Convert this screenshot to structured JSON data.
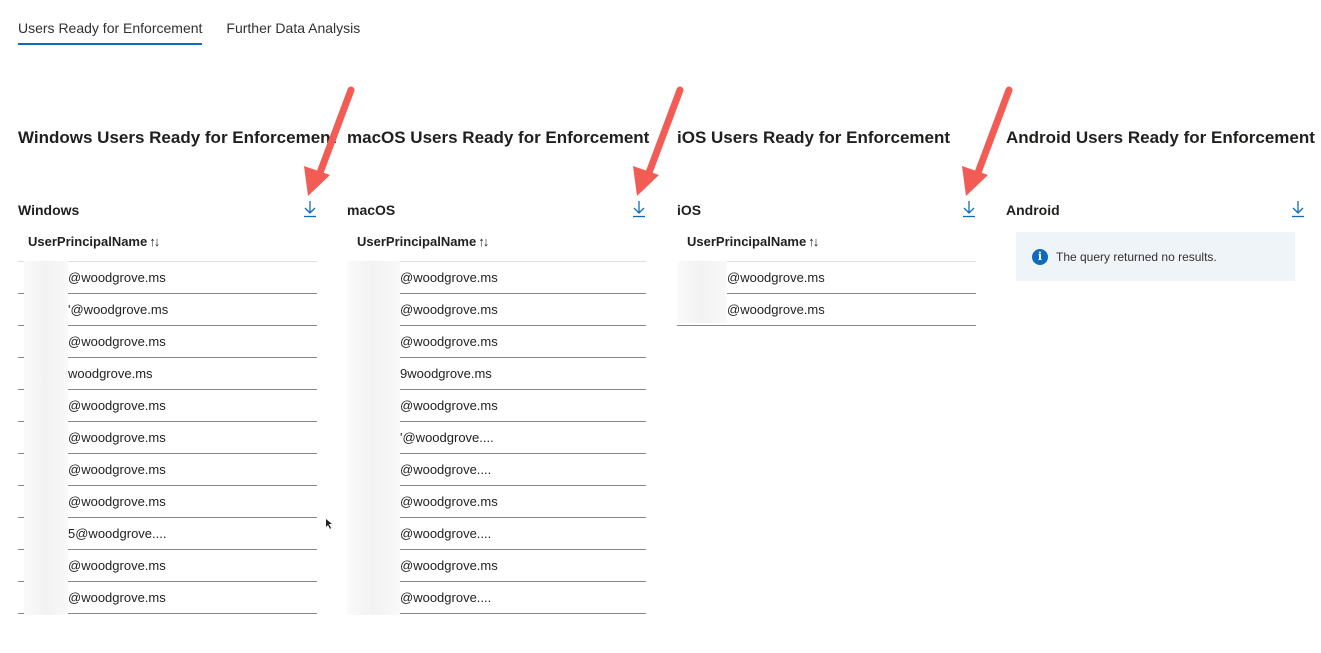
{
  "tabs": [
    {
      "label": "Users Ready for Enforcement",
      "active": true
    },
    {
      "label": "Further Data Analysis",
      "active": false
    }
  ],
  "colors": {
    "accent": "#0f6cbd",
    "annotation_arrow": "#f25c54",
    "info_bg": "#eff4f9"
  },
  "panels": {
    "windows": {
      "title": "Windows Users Ready for Enforcement",
      "sub_label": "Windows",
      "column_header": "UserPrincipalName",
      "rows": [
        "@woodgrove.ms",
        "'@woodgrove.ms",
        "@woodgrove.ms",
        "woodgrove.ms",
        "@woodgrove.ms",
        "@woodgrove.ms",
        "@woodgrove.ms",
        "@woodgrove.ms",
        "5@woodgrove....",
        "@woodgrove.ms",
        "@woodgrove.ms"
      ]
    },
    "macos": {
      "title": "macOS Users Ready for Enforcement",
      "sub_label": "macOS",
      "column_header": "UserPrincipalName",
      "rows": [
        "@woodgrove.ms",
        "@woodgrove.ms",
        "@woodgrove.ms",
        "9woodgrove.ms",
        "@woodgrove.ms",
        "'@woodgrove....",
        "@woodgrove....",
        "@woodgrove.ms",
        "@woodgrove....",
        "@woodgrove.ms",
        "@woodgrove...."
      ]
    },
    "ios": {
      "title": "iOS Users Ready for Enforcement",
      "sub_label": "iOS",
      "column_header": "UserPrincipalName",
      "rows": [
        "@woodgrove.ms",
        "@woodgrove.ms"
      ]
    },
    "android": {
      "title": "Android Users Ready for Enforcement",
      "sub_label": "Android",
      "empty_message": "The query returned no results."
    }
  },
  "icons": {
    "download": "download-icon",
    "sort": "sort-icon",
    "info": "info-icon"
  }
}
